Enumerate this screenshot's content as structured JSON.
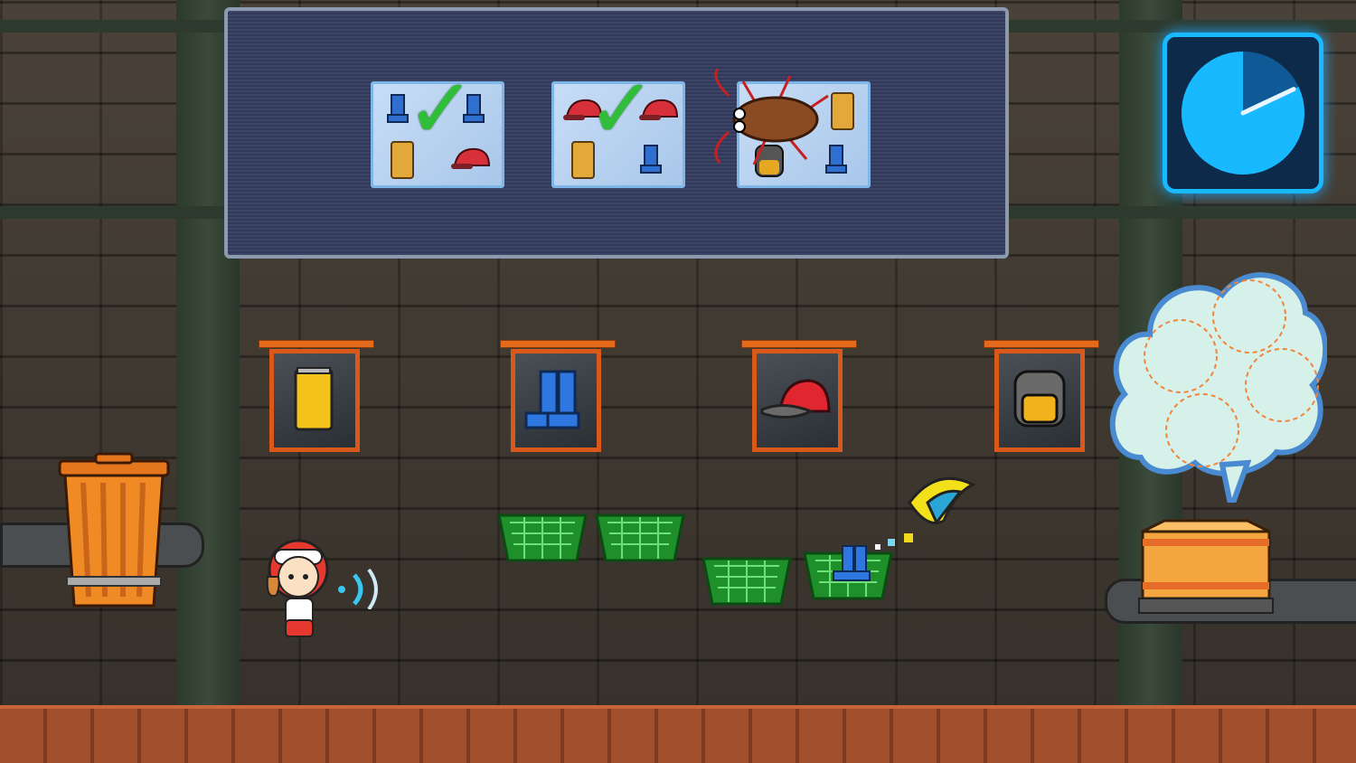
{
  "game": {
    "clock": {
      "remaining_fraction": 0.82,
      "color": "#19b9ff"
    },
    "orders": [
      {
        "items": [
          "boots-icon",
          "boots-icon",
          "can-icon",
          "cap-icon"
        ],
        "completed": true
      },
      {
        "items": [
          "cap-icon",
          "cap-icon",
          "can-icon",
          "boots-icon"
        ],
        "completed": true
      },
      {
        "items": [
          "can-icon",
          "backpack-icon",
          "boots-icon"
        ],
        "completed": false,
        "blocked_by": "cockroach-icon"
      }
    ],
    "bins": [
      "can-icon",
      "boots-icon",
      "cap-icon",
      "backpack-icon"
    ],
    "baskets": [
      {
        "contents": null
      },
      {
        "contents": null
      },
      {
        "contents": null
      },
      {
        "contents": "boots-icon"
      }
    ],
    "thought_bubble_slots": 4,
    "colors": {
      "check": "#2fbd3a",
      "bin_frame": "#d8591a",
      "basket": "#2bbf3a"
    }
  }
}
